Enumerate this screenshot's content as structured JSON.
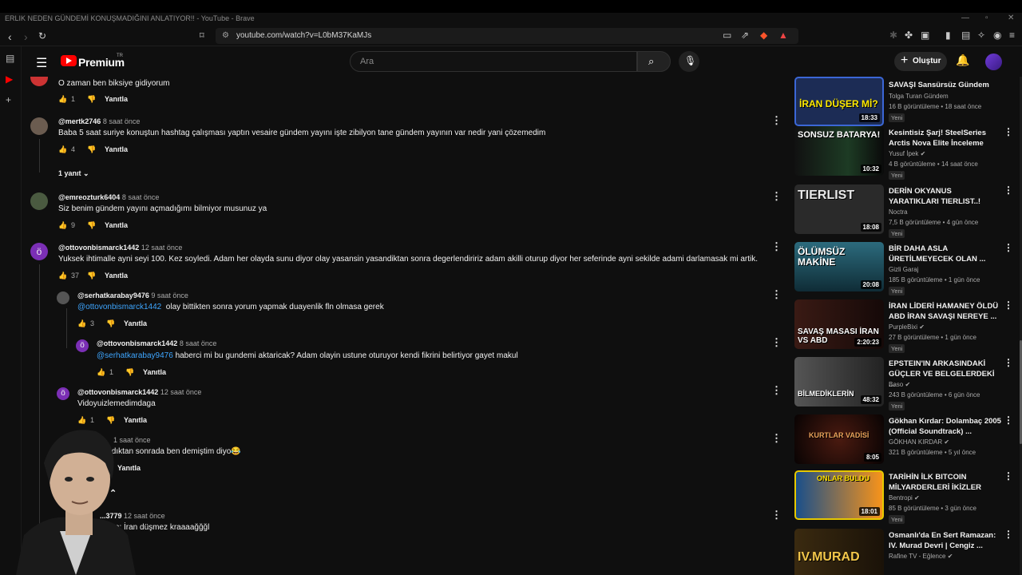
{
  "window": {
    "title": "ERLIK NEDEN GÜNDEMİ KONUŞMADIĞINI ANLATIYOR!! - YouTube - Brave",
    "url": "youtube.com/watch?v=L0bM37KaMJs"
  },
  "header": {
    "brand": "Premium",
    "brand_sup": "TR",
    "search_placeholder": "Ara",
    "create_label": "Oluştur"
  },
  "comments": [
    {
      "handle": "",
      "time": "",
      "text": "O zaman ben biksiye gidiyorum",
      "likes": "1",
      "reply": "Yanıtla"
    },
    {
      "handle": "@mertk2746",
      "time": "8 saat önce",
      "text": "Baba 5 saat suriye konuştun hashtag çalışması yaptın vesaire gündem yayını işte zibilyon tane gündem yayının var nedir yani çözemedim",
      "likes": "4",
      "reply": "Yanıtla",
      "replies_toggle": "1 yanıt"
    },
    {
      "handle": "@emreozturk6404",
      "time": "8 saat önce",
      "text": "Siz benim gündem yayını açmadığımı bilmiyor musunuz ya",
      "likes": "9",
      "reply": "Yanıtla"
    },
    {
      "handle": "@ottovonbismarck1442",
      "time": "12 saat önce",
      "text": "Yuksek ihtimalle ayni seyi 100. Kez soyledi. Adam her olayda sunu diyor olay yasansin yasandiktan sonra degerlendiririz adam akilli oturup diyor her seferinde ayni sekilde adami darlamasak mi artik.",
      "likes": "37",
      "reply": "Yanıtla"
    },
    {
      "handle": "@serhatkarabay9476",
      "time": "9 saat önce",
      "mention": "@ottovonbismarck1442",
      "text": "olay bittikten sonra yorum yapmak duayenlik fln olmasa gerek",
      "likes": "3",
      "reply": "Yanıtla"
    },
    {
      "handle": "@ottovonbismarck1442",
      "time": "8 saat önce",
      "mention": "@serhatkarabay9476",
      "text": "haberci mi bu gundemi aktaricak? Adam olayin ustune oturuyor kendi fikrini belirtiyor gayet makul",
      "likes": "1",
      "reply": "Yanıtla"
    },
    {
      "handle": "@ottovonbismarck1442",
      "time": "12 saat önce",
      "text": "Vidoyuizlemedimdaga",
      "likes": "1",
      "reply": "Yanıtla"
    },
    {
      "handle": "",
      "time": "1 saat önce",
      "text": "ıdıktan sonrada ben demiştim diyo😂",
      "likes": "",
      "reply": "Yanıtla"
    },
    {
      "handle": "...3779",
      "time": "12 saat önce",
      "text": "...nce: İran düşmez kraaaağğğl",
      "likes": "",
      "reply": ""
    }
  ],
  "sidebar": [
    {
      "thumb_text": "İRAN DÜŞER Mİ?",
      "duration": "18:33",
      "title": "SAVAŞI Sansürsüz Gündem",
      "channel": "Tolga Turan Gündem",
      "verified": false,
      "meta": "16 B görüntüleme • 18 saat önce",
      "badge": "Yeni",
      "thumb_color": "#1c2c55"
    },
    {
      "thumb_text": "SONSUZ BATARYA!",
      "duration": "10:32",
      "title": "Kesintisiz Şarj! SteelSeries Arctis Nova Elite İnceleme",
      "channel": "Yusuf İpek",
      "verified": true,
      "meta": "4 B görüntüleme • 14 saat önce",
      "badge": "Yeni",
      "thumb_color": "#1d3b24"
    },
    {
      "thumb_text": "TIERLIST",
      "duration": "18:08",
      "title": "DERİN OKYANUS YARATIKLARI TIERLIST..!",
      "channel": "Noctra",
      "verified": false,
      "meta": "7,5 B görüntüleme • 4 gün önce",
      "badge": "Yeni",
      "thumb_color": "#2a2a2a"
    },
    {
      "thumb_text": "ÖLÜMSÜZ MAKİNE",
      "duration": "20:08",
      "title": "BİR DAHA ASLA ÜRETİLMEYECEK OLAN ...",
      "channel": "Gizli Garaj",
      "verified": false,
      "meta": "185 B görüntüleme • 1 gün önce",
      "badge": "Yeni",
      "thumb_color": "#1e4a5a"
    },
    {
      "thumb_text": "SAVAŞ MASASI İRAN VS ABD",
      "duration": "2:20:23",
      "title": "İRAN LİDERİ HAMANEY ÖLDÜ ABD İRAN SAVAŞI NEREYE ...",
      "channel": "PurpleBixi",
      "verified": true,
      "meta": "27 B görüntüleme • 1 gün önce",
      "badge": "Yeni",
      "thumb_color": "#3a1a14"
    },
    {
      "thumb_text": "BİLMEDİKLERİN",
      "duration": "48:32",
      "title": "EPSTEIN'IN ARKASINDAKİ GÜÇLER VE BELGELERDEKİ ...",
      "channel": "Baso",
      "verified": true,
      "meta": "243 B görüntüleme • 6 gün önce",
      "badge": "Yeni",
      "thumb_color": "#3a3a3a"
    },
    {
      "thumb_text": "KURTLAR VADİSİ",
      "duration": "8:05",
      "title": "Gökhan Kırdar: Dolambaç 2005 (Official Soundtrack) ...",
      "channel": "GÖKHAN KIRDAR",
      "verified": true,
      "meta": "321 B görüntüleme • 5 yıl önce",
      "badge": "",
      "thumb_color": "#120606"
    },
    {
      "thumb_text": "ONLAR BULDU",
      "duration": "18:01",
      "title": "TARİHİN İLK BITCOIN MİLYARDERLERİ İKİZLER",
      "channel": "Bentropi",
      "verified": true,
      "meta": "85 B görüntüleme • 3 gün önce",
      "badge": "Yeni",
      "thumb_color": "#1a4f8a"
    },
    {
      "thumb_text": "IV.MURAD",
      "duration": "",
      "title": "Osmanlı'da En Sert Ramazan: IV. Murad Devri | Cengiz ...",
      "channel": "Rafine TV - Eğlence",
      "verified": true,
      "meta": "",
      "badge": "",
      "thumb_color": "#3a2a10"
    }
  ]
}
